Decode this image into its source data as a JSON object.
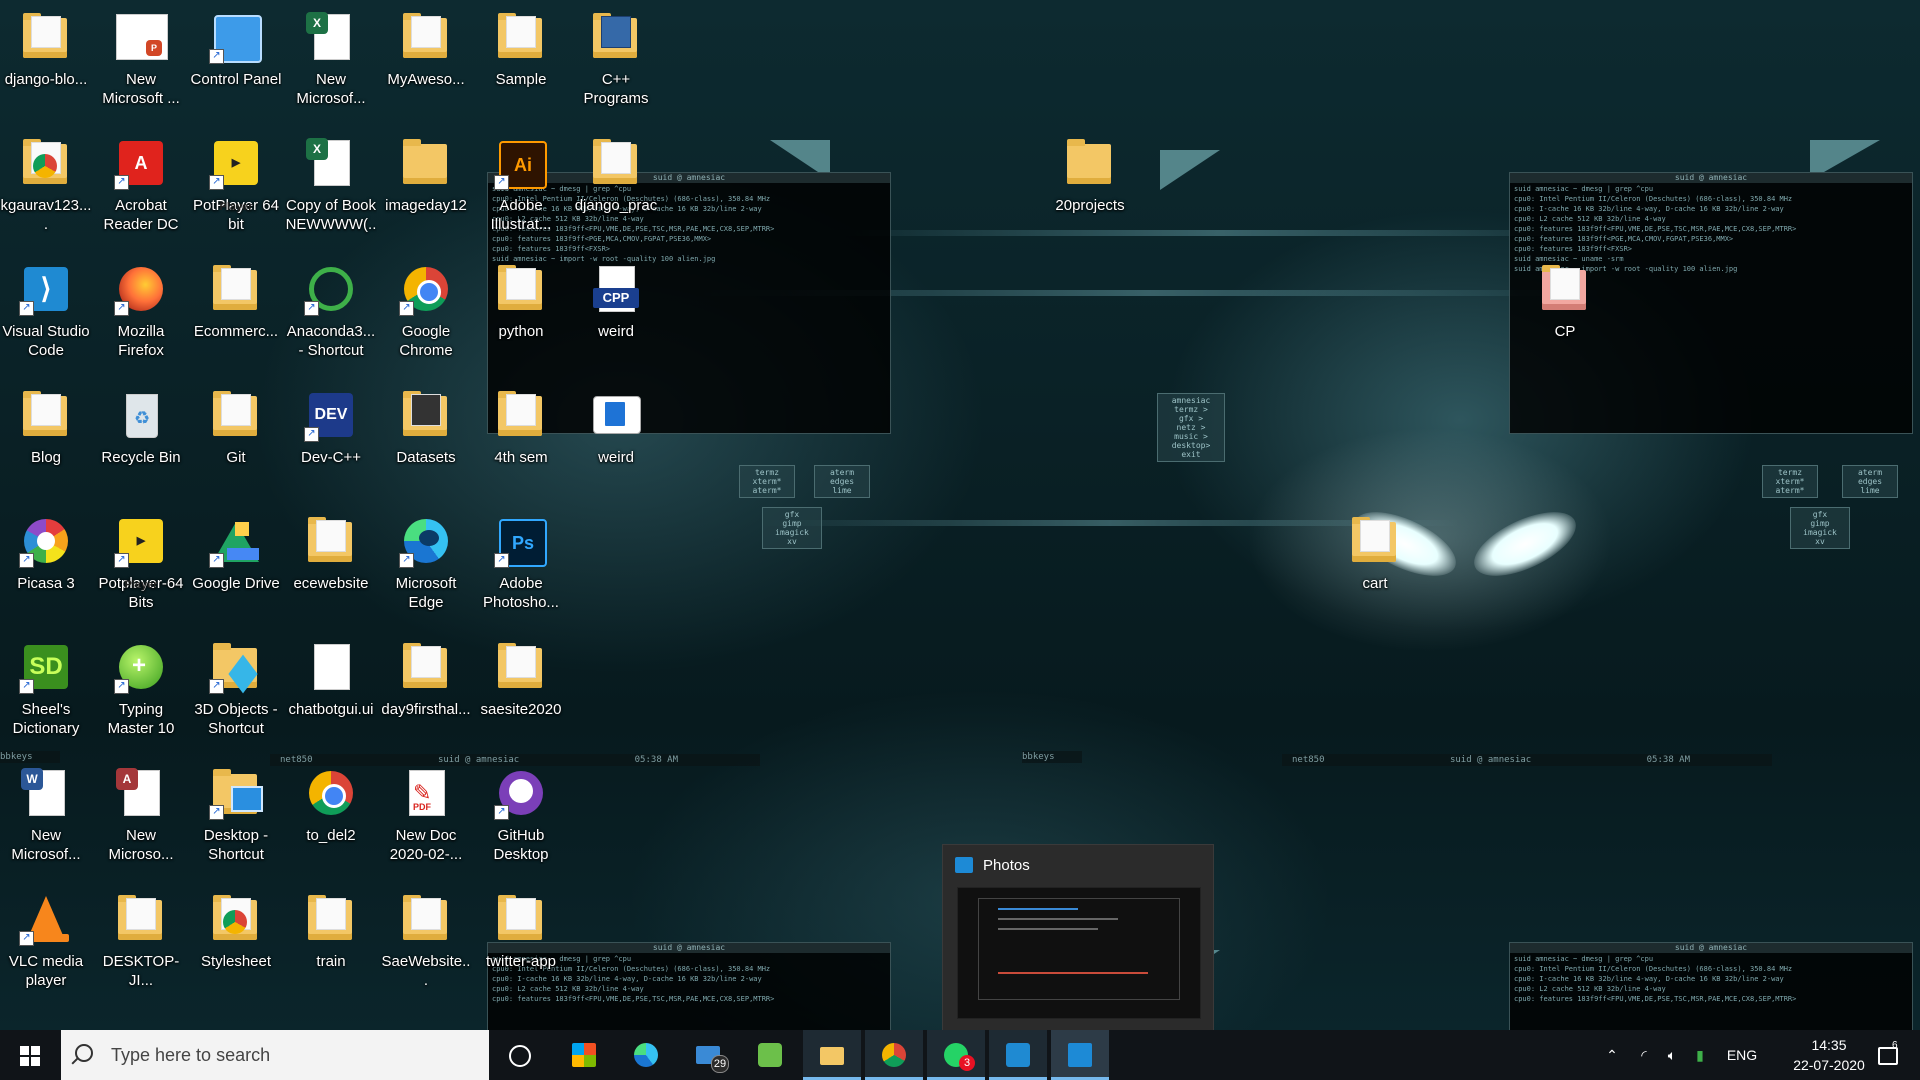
{
  "desktop": {
    "icons": [
      {
        "label": "django-blo...",
        "icon": "folder-icon"
      },
      {
        "label": "New Microsoft ...",
        "icon": "powerpoint-icon"
      },
      {
        "label": "Control Panel",
        "icon": "control-panel-icon"
      },
      {
        "label": "New Microsof...",
        "icon": "excel-icon"
      },
      {
        "label": "MyAweso...",
        "icon": "folder-icon"
      },
      {
        "label": "Sample",
        "icon": "folder-icon"
      },
      {
        "label": "C++ Programs",
        "icon": "folder-icon"
      },
      {
        "label": "kgaurav123....",
        "icon": "chrome-folder-icon"
      },
      {
        "label": "Acrobat Reader DC",
        "icon": "acrobat-icon"
      },
      {
        "label": "PotPlayer 64 bit",
        "icon": "potplayer-icon"
      },
      {
        "label": "Copy of Book NEWWWW(...",
        "icon": "excel-icon"
      },
      {
        "label": "imageday12",
        "icon": "folder-icon"
      },
      {
        "label": "Adobe Illustrat...",
        "icon": "illustrator-icon"
      },
      {
        "label": "django_prac",
        "icon": "folder-icon"
      },
      {
        "label": "20projects",
        "icon": "folder-icon"
      },
      {
        "label": "Visual Studio Code",
        "icon": "vscode-icon"
      },
      {
        "label": "Mozilla Firefox",
        "icon": "firefox-icon"
      },
      {
        "label": "Ecommerc...",
        "icon": "folder-icon"
      },
      {
        "label": "Anaconda3... - Shortcut",
        "icon": "anaconda-icon"
      },
      {
        "label": "Google Chrome",
        "icon": "chrome-icon"
      },
      {
        "label": "python",
        "icon": "folder-icon"
      },
      {
        "label": "weird",
        "icon": "cpp-file-icon"
      },
      {
        "label": "CP",
        "icon": "folder-icon"
      },
      {
        "label": "Blog",
        "icon": "folder-icon"
      },
      {
        "label": "Recycle Bin",
        "icon": "recycle-bin-icon"
      },
      {
        "label": "Git",
        "icon": "folder-icon"
      },
      {
        "label": "Dev-C++",
        "icon": "devcpp-icon"
      },
      {
        "label": "Datasets",
        "icon": "folder-icon"
      },
      {
        "label": "4th sem",
        "icon": "folder-icon"
      },
      {
        "label": "weird",
        "icon": "exe-icon"
      },
      {
        "label": "Picasa 3",
        "icon": "picasa-icon"
      },
      {
        "label": "Potplayer-64 Bits",
        "icon": "potplayer-icon"
      },
      {
        "label": "Google Drive",
        "icon": "google-drive-icon"
      },
      {
        "label": "ecewebsite",
        "icon": "folder-icon"
      },
      {
        "label": "Microsoft Edge",
        "icon": "edge-icon"
      },
      {
        "label": "Adobe Photosho...",
        "icon": "photoshop-icon"
      },
      {
        "label": "cart",
        "icon": "folder-icon"
      },
      {
        "label": "Sheel's Dictionary",
        "icon": "dictionary-icon"
      },
      {
        "label": "Typing Master 10",
        "icon": "typing-master-icon"
      },
      {
        "label": "3D Objects - Shortcut",
        "icon": "3d-objects-icon"
      },
      {
        "label": "chatbotgui.ui",
        "icon": "blank-file-icon"
      },
      {
        "label": "day9firsthal...",
        "icon": "folder-icon"
      },
      {
        "label": "saesite2020",
        "icon": "folder-icon"
      },
      {
        "label": "New Microsof...",
        "icon": "word-icon"
      },
      {
        "label": "New Microso...",
        "icon": "access-icon"
      },
      {
        "label": "Desktop - Shortcut",
        "icon": "desktop-shortcut-icon"
      },
      {
        "label": "to_del2",
        "icon": "chrome-icon"
      },
      {
        "label": "New Doc 2020-02-...",
        "icon": "pdf-icon"
      },
      {
        "label": "GitHub Desktop",
        "icon": "github-icon"
      },
      {
        "label": "VLC media player",
        "icon": "vlc-icon"
      },
      {
        "label": "DESKTOP-JI...",
        "icon": "folder-icon"
      },
      {
        "label": "Stylesheet",
        "icon": "chrome-folder-icon"
      },
      {
        "label": "train",
        "icon": "folder-icon"
      },
      {
        "label": "SaeWebsite...",
        "icon": "folder-icon"
      },
      {
        "label": "twitter-app",
        "icon": "folder-icon"
      }
    ]
  },
  "wallpaper": {
    "term_title": "suid @ amnesiac",
    "term_lines": [
      "suid amnesiac ~ dmesg | grep ^cpu",
      "cpu0: Intel Pentium II/Celeron (Deschutes) (686-class), 350.84 MHz",
      "cpu0: I-cache 16 KB 32b/line 4-way, D-cache 16 KB 32b/line 2-way",
      "cpu0: L2 cache 512 KB 32b/line 4-way",
      "cpu0: features 183f9ff<FPU,VME,DE,PSE,TSC,MSR,PAE,MCE,CX8,SEP,MTRR>",
      "cpu0: features 183f9ff<PGE,MCA,CMOV,FGPAT,PSE36,MMX>",
      "cpu0: features 183f9ff<FXSR>",
      "suid amnesiac ~ uname -srm",
      "suid amnesiac ~ import -w root -quality 100 alien.jpg"
    ],
    "menu_main": [
      "amnesiac",
      "termz >",
      "gfx >",
      "netz >",
      "music >",
      "desktop>",
      "exit"
    ],
    "menu_term": [
      "termz",
      "xterm*",
      "aterm*"
    ],
    "menu_edge": [
      "aterm",
      "edges",
      "lime"
    ],
    "menu_gfx": [
      "gfx",
      "gimp",
      "imagick",
      "xv"
    ],
    "bar_left": "bbkeys",
    "bar_net": "net850",
    "bar_title": "suid @ amnesiac",
    "bar_time": "05:38 AM"
  },
  "thumbnail": {
    "title": "Photos"
  },
  "taskbar": {
    "search_placeholder": "Type here to search",
    "apps": [
      {
        "name": "task-view",
        "icon": "task-view-icon"
      },
      {
        "name": "store",
        "icon": "store-icon"
      },
      {
        "name": "edge",
        "icon": "edge-icon"
      },
      {
        "name": "mail",
        "icon": "mail-icon",
        "badge": "29"
      },
      {
        "name": "feedly",
        "icon": "feedly-icon"
      },
      {
        "name": "file-explorer",
        "icon": "folder-icon"
      },
      {
        "name": "chrome",
        "icon": "chrome-icon"
      },
      {
        "name": "whatsapp",
        "icon": "whatsapp-icon",
        "badge": "3"
      },
      {
        "name": "vscode",
        "icon": "vscode-icon"
      },
      {
        "name": "photos",
        "icon": "photos-icon"
      }
    ],
    "tray": {
      "language": "ENG",
      "time": "14:35",
      "date": "22-07-2020",
      "notification_count": "6"
    }
  },
  "colors": {
    "taskbar_bg": "#101418",
    "accent": "#76b9ed",
    "folder": "#f3c765"
  }
}
